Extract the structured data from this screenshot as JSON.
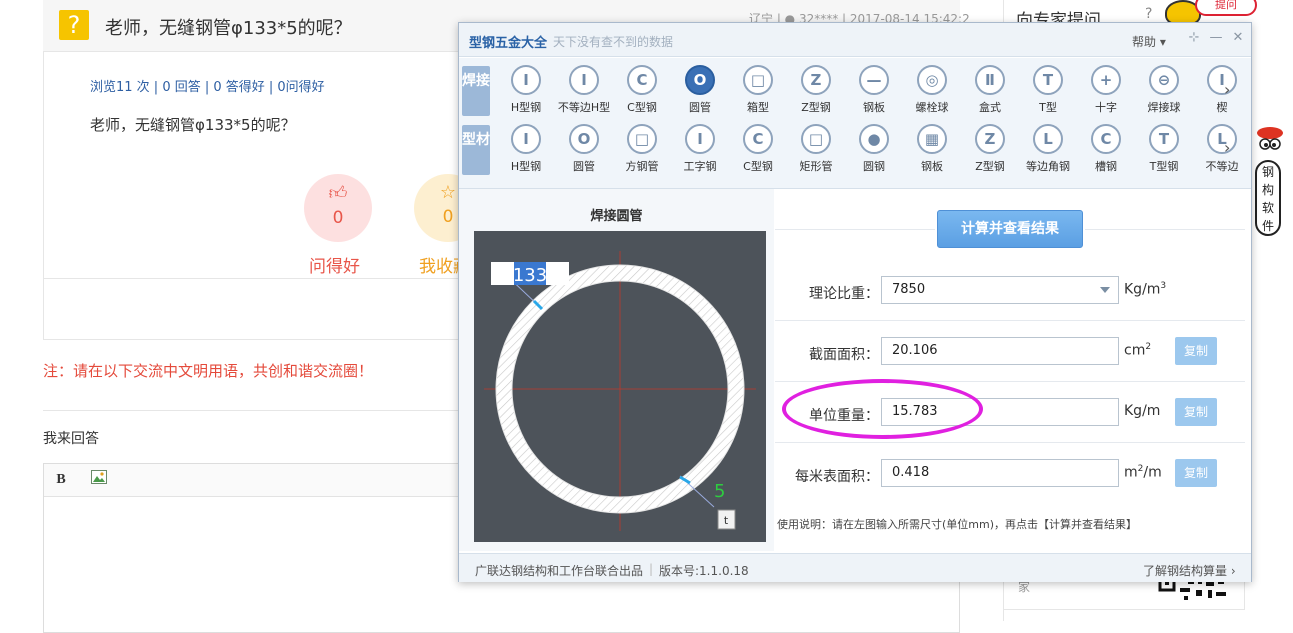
{
  "question": {
    "title": "老师，无缝钢管φ133*5的呢？",
    "meta": "辽宁 | ● 32**** | 2017-08-14 15:42:2",
    "stats": "浏览11 次 | 0 回答 | 0 答得好 | 0问得好",
    "body": "老师，无缝钢管φ133*5的呢？",
    "votes": [
      {
        "count": "0",
        "label": "问得好",
        "icon": "thumbs-up-icon",
        "color": "#e8564a"
      },
      {
        "count": "0",
        "label": "我收藏",
        "icon": "star-icon",
        "color": "#f0a020"
      }
    ]
  },
  "notice": "注：请在以下交流中文明用语，共创和谐交流圈！",
  "answer": {
    "label": "我来回答",
    "bold_label": "B"
  },
  "sidebar": {
    "expert_title": "向专家提问",
    "ask_label": "提问",
    "key_char": "?",
    "bubble_chars": [
      "钢",
      "构",
      "软",
      "件"
    ],
    "bottom_text": "家"
  },
  "dialog": {
    "title": "型钢五金大全",
    "subtitle": "天下没有查不到的数据",
    "help_label": "帮助 ▾",
    "row1_tag": "焊接",
    "row2_tag": "型材",
    "row1_tools": [
      {
        "label": "H型钢",
        "glyph": "I",
        "icon": "h-beam-icon"
      },
      {
        "label": "不等边H型",
        "glyph": "I",
        "icon": "unequal-h-icon"
      },
      {
        "label": "C型钢",
        "glyph": "C",
        "icon": "c-channel-icon"
      },
      {
        "label": "圆管",
        "glyph": "O",
        "icon": "round-pipe-icon",
        "active": true
      },
      {
        "label": "箱型",
        "glyph": "□",
        "icon": "box-section-icon"
      },
      {
        "label": "Z型钢",
        "glyph": "Z",
        "icon": "z-section-icon"
      },
      {
        "label": "钢板",
        "glyph": "—",
        "icon": "steel-plate-icon"
      },
      {
        "label": "螺栓球",
        "glyph": "◎",
        "icon": "bolt-ball-icon"
      },
      {
        "label": "盒式",
        "glyph": "Ⅱ",
        "icon": "box-type-icon"
      },
      {
        "label": "T型",
        "glyph": "T",
        "icon": "t-section-icon"
      },
      {
        "label": "十字",
        "glyph": "+",
        "icon": "cross-section-icon"
      },
      {
        "label": "焊接球",
        "glyph": "⊖",
        "icon": "weld-ball-icon"
      },
      {
        "label": "楔",
        "glyph": "I",
        "icon": "wedge-icon"
      }
    ],
    "row2_tools": [
      {
        "label": "H型钢",
        "glyph": "I",
        "icon": "h-beam-icon"
      },
      {
        "label": "圆管",
        "glyph": "O",
        "icon": "round-pipe-icon"
      },
      {
        "label": "方钢管",
        "glyph": "□",
        "icon": "square-pipe-icon"
      },
      {
        "label": "工字钢",
        "glyph": "I",
        "icon": "i-beam-icon"
      },
      {
        "label": "C型钢",
        "glyph": "C",
        "icon": "c-channel-icon"
      },
      {
        "label": "矩形管",
        "glyph": "□",
        "icon": "rect-pipe-icon"
      },
      {
        "label": "圆钢",
        "glyph": "●",
        "icon": "round-bar-icon"
      },
      {
        "label": "钢板",
        "glyph": "▦",
        "icon": "steel-plate-icon"
      },
      {
        "label": "Z型钢",
        "glyph": "Z",
        "icon": "z-section-icon"
      },
      {
        "label": "等边角钢",
        "glyph": "L",
        "icon": "equal-angle-icon"
      },
      {
        "label": "槽钢",
        "glyph": "C",
        "icon": "channel-icon"
      },
      {
        "label": "T型钢",
        "glyph": "T",
        "icon": "t-section-icon"
      },
      {
        "label": "不等边",
        "glyph": "L",
        "icon": "unequal-angle-icon"
      }
    ],
    "drawing": {
      "title": "焊接圆管",
      "diameter": "133",
      "thickness": "5",
      "thickness_tag": "t"
    },
    "calc_button": "计算并查看结果",
    "fields": [
      {
        "label": "理论比重：",
        "value": "7850",
        "unit": "Kg/m",
        "sup": "3",
        "copy": "",
        "dropdown": true
      },
      {
        "label": "截面面积：",
        "value": "20.106",
        "unit": "cm",
        "sup": "2",
        "copy": "复制"
      },
      {
        "label": "单位重量：",
        "value": "15.783",
        "unit": "Kg/m",
        "sup": "",
        "copy": "复制"
      },
      {
        "label": "每米表面积：",
        "value": "0.418",
        "unit": "m",
        "sup": "2",
        "unit_suffix": "/m",
        "copy": "复制"
      }
    ],
    "usage": "使用说明：请在左图输入所需尺寸(单位mm)，再点击【计算并查看结果】",
    "footer_left": "广联达钢结构和工作台联合出品",
    "footer_version": "版本号:1.1.0.18",
    "footer_right": "了解钢结构算量"
  }
}
